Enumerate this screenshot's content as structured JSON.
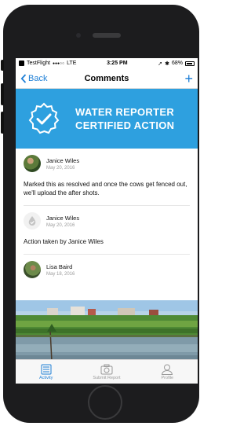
{
  "status_bar": {
    "carrier": "TestFlight",
    "signal": "●●●○○",
    "network": "LTE",
    "time": "3:25 PM",
    "battery": "68%"
  },
  "nav": {
    "back_label": "Back",
    "title": "Comments",
    "add_icon": "plus-icon"
  },
  "banner": {
    "line1": "WATER REPORTER",
    "line2": "CERTIFIED ACTION",
    "color": "#2ea0df"
  },
  "comments": [
    {
      "author": "Janice Wiles",
      "date": "May 20, 2016",
      "text": "Marked this as resolved and once the cows get fenced out, we'll upload the after shots."
    },
    {
      "author": "Janice Wiles",
      "date": "May 20, 2016",
      "text": "Action taken by Janice Wiles"
    },
    {
      "author": "Lisa Baird",
      "date": "May 18, 2016"
    }
  ],
  "tabs": [
    {
      "label": "Activity",
      "icon": "activity-icon"
    },
    {
      "label": "Submit Report",
      "icon": "camera-icon"
    },
    {
      "label": "Profile",
      "icon": "profile-icon"
    }
  ],
  "colors": {
    "accent": "#1e7fd6",
    "banner": "#2ea0df"
  }
}
